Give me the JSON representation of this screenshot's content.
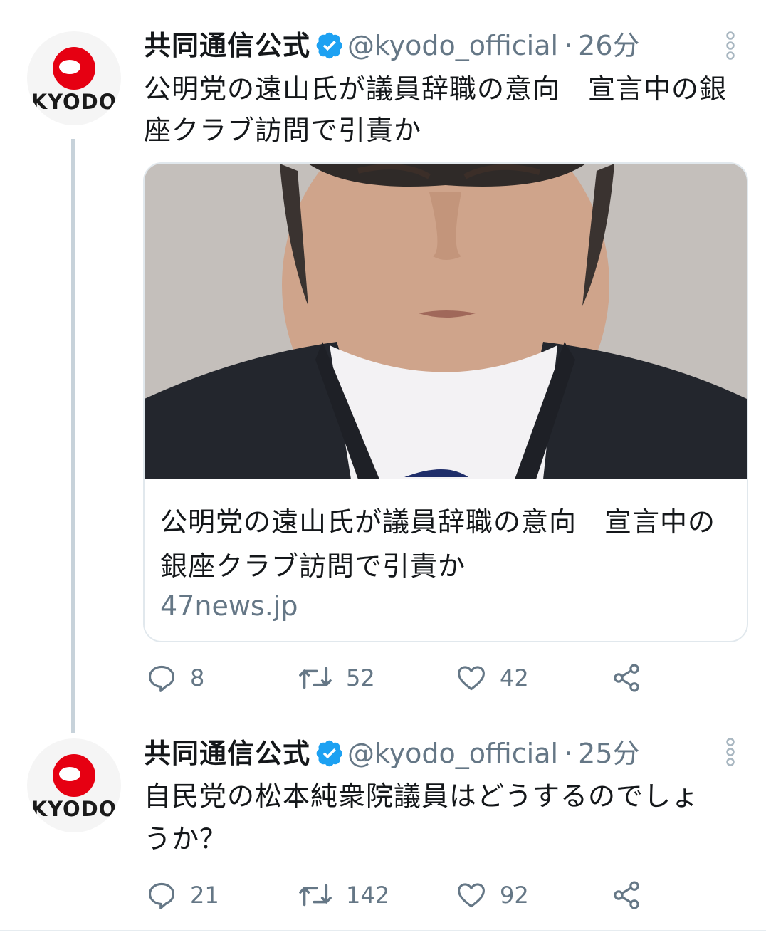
{
  "tweets": [
    {
      "avatar_label": "KYODO",
      "display_name": "共同通信公式",
      "handle": "@kyodo_official",
      "separator": "·",
      "time": "26分",
      "text": "公明党の遠山氏が議員辞職の意向　宣言中の銀座クラブ訪問で引責か",
      "card": {
        "title": "公明党の遠山氏が議員辞職の意向　宣言中の銀座クラブ訪問で引責か",
        "domain": "47news.jp"
      },
      "stats": {
        "replies": "8",
        "retweets": "52",
        "likes": "42"
      }
    },
    {
      "avatar_label": "KYODO",
      "display_name": "共同通信公式",
      "handle": "@kyodo_official",
      "separator": "·",
      "time": "25分",
      "text": "自民党の松本純衆院議員はどうするのでしょうか？",
      "stats": {
        "replies": "21",
        "retweets": "142",
        "likes": "92"
      }
    }
  ],
  "colors": {
    "verified": "#1da1f2",
    "secondary_text": "#657786",
    "kyodo_red": "#e60012",
    "thread_line": "#c7d2da"
  },
  "icons": [
    "verified-badge-icon",
    "more-options-icon",
    "reply-icon",
    "retweet-icon",
    "like-icon",
    "share-icon"
  ]
}
